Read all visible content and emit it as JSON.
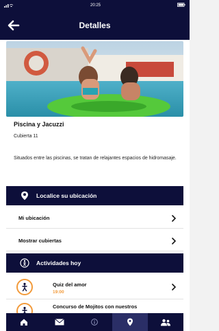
{
  "status": {
    "time": "20:25",
    "left_icons": "signal-wifi-icon",
    "right_icons": "battery-icon"
  },
  "appbar": {
    "title": "Detalles",
    "back_icon": "back-arrow-icon"
  },
  "venue": {
    "name": "Piscina y Jacuzzi",
    "deck": "Cubierta 11",
    "description": "Situados entre las piscinas, se tratan de relajantes espacios de hidromasaje."
  },
  "location": {
    "header": "Localice su ubicación",
    "header_icon": "map-pin-icon",
    "rows": [
      {
        "label": "Mi ubicación"
      },
      {
        "label": "Mostrar cubiertas"
      }
    ]
  },
  "activities": {
    "header": "Actividades hoy",
    "header_icon": "activity-icon",
    "items": [
      {
        "title": "Quiz del amor",
        "time": "19:00"
      },
      {
        "title": "Concurso de Mojitos con nuestros",
        "time": ""
      }
    ]
  },
  "tabs": [
    {
      "name": "home",
      "icon": "home-icon"
    },
    {
      "name": "messages",
      "icon": "envelope-icon"
    },
    {
      "name": "info",
      "icon": "info-icon"
    },
    {
      "name": "location",
      "icon": "location-pin-icon",
      "active": true
    },
    {
      "name": "people",
      "icon": "people-icon"
    }
  ],
  "colors": {
    "navy": "#0d0f3a",
    "accent": "#f29a3a"
  }
}
